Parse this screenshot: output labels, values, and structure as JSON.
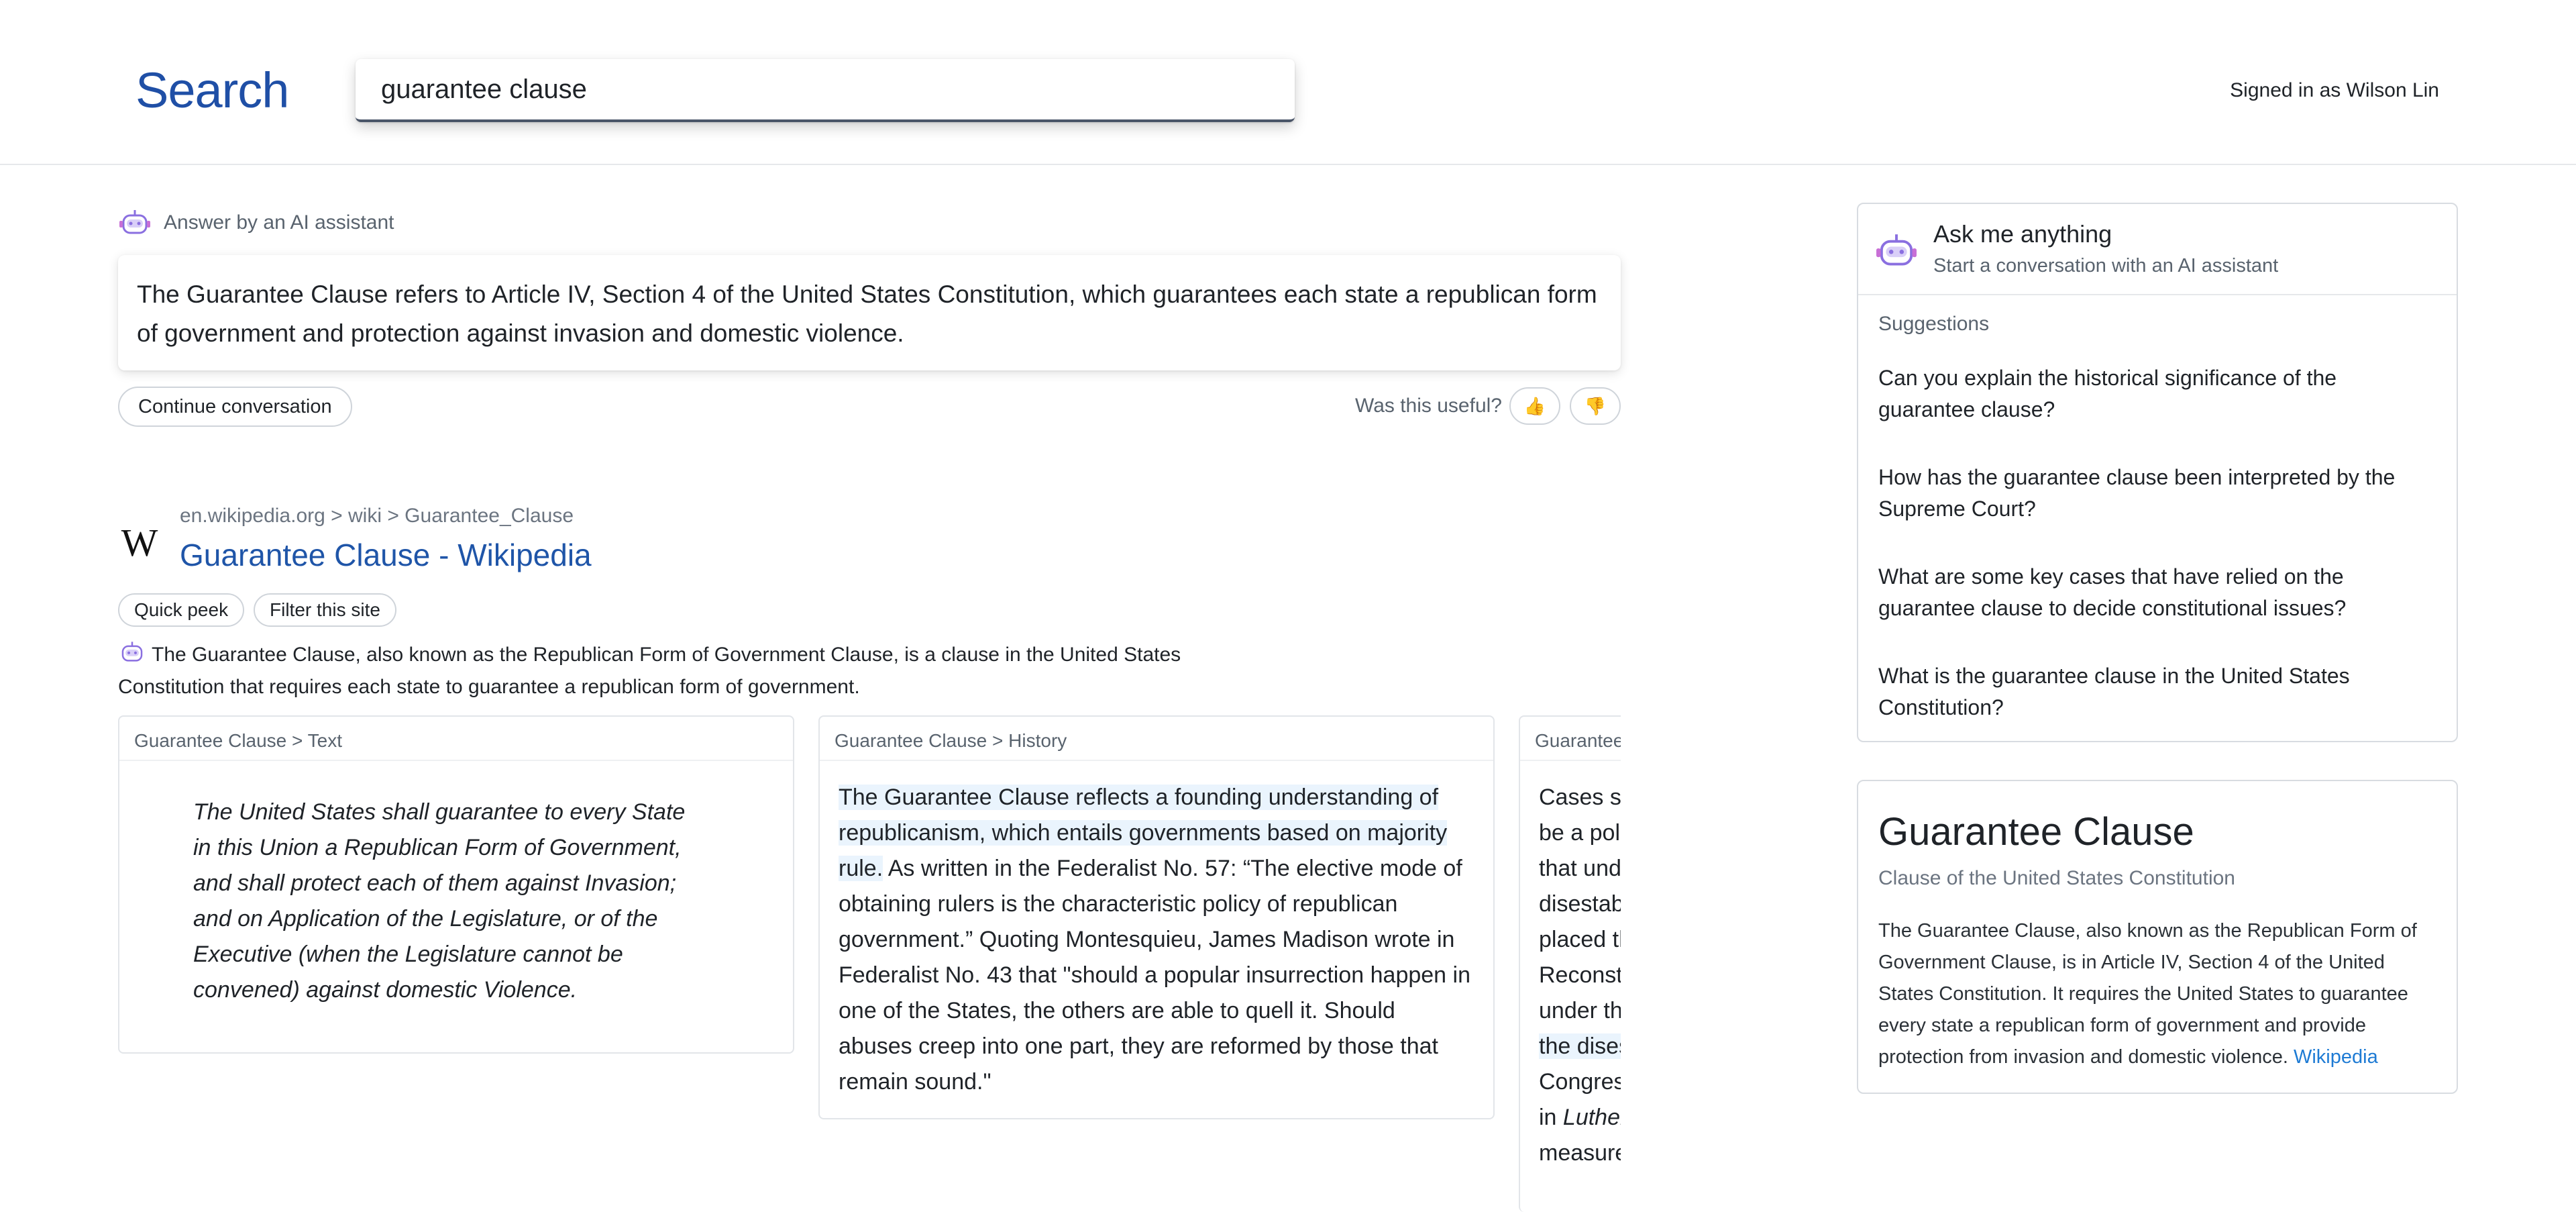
{
  "header": {
    "brand": "Search",
    "search_value": "guarantee clause",
    "signed_in": "Signed in as Wilson Lin"
  },
  "ai_answer": {
    "label": "Answer by an AI assistant",
    "text": "The Guarantee Clause refers to Article IV, Section 4 of the United States Constitution, which guarantees each state a republican form of government and protection against invasion and domestic violence.",
    "continue_label": "Continue conversation",
    "useful_label": "Was this useful?",
    "thumbs_up": "👍",
    "thumbs_down": "👎",
    "icon": "robot-icon"
  },
  "result": {
    "logo": "W",
    "breadcrumb": "en.wikipedia.org > wiki > Guarantee_Clause",
    "title": "Guarantee Clause - Wikipedia",
    "quick_peek": "Quick peek",
    "filter_site": "Filter this site",
    "snippet": "The Guarantee Clause, also known as the Republican Form of Government Clause, is a clause in the United States Constitution that requires each state to guarantee a republican form of government.",
    "excerpts": [
      {
        "heading": "Guarantee Clause > Text",
        "body": "The United States shall guarantee to every State in this Union a Republican Form of Government, and shall protect each of them against Invasion; and on Application of the Legislature, or of the Executive (when the Legislature cannot be convened) against domestic Violence."
      },
      {
        "heading": "Guarantee Clause > History",
        "highlight": "The Guarantee Clause reflects a founding understanding of republicanism, which entails governments based on majority rule.",
        "body": " As written in the Federalist No. 57: “The elective mode of obtaining rulers is the characteristic policy of republican government.” Quoting Montesquieu, James Madison wrote in Federalist No. 43 that \"should a popular insurrection happen in one of the States, the others are able to quell it. Should abuses creep into one part, they are reformed by those that remain sound.\""
      },
      {
        "heading": "Guarantee",
        "lines": [
          "Cases su",
          "be a poli",
          "that und",
          "disestab",
          "placed th",
          "Reconstr",
          "under th",
          "the dises",
          "Congres",
          "in ",
          "measure"
        ],
        "italic_word": "Luther"
      }
    ]
  },
  "ask_panel": {
    "title": "Ask me anything",
    "subtitle": "Start a conversation with an AI assistant",
    "suggestions_label": "Suggestions",
    "suggestions": [
      "Can you explain the historical significance of the guarantee clause?",
      "How has the guarantee clause been interpreted by the Supreme Court?",
      "What are some key cases that have relied on the guarantee clause to decide constitutional issues?",
      "What is the guarantee clause in the United States Constitution?"
    ]
  },
  "knowledge_panel": {
    "title": "Guarantee Clause",
    "subtitle": "Clause of the United States Constitution",
    "description": "The Guarantee Clause, also known as the Republican Form of Government Clause, is in Article IV, Section 4 of the United States Constitution. It requires the United States to guarantee every state a republican form of government and provide protection from invasion and domestic violence. ",
    "source_link": "Wikipedia"
  }
}
